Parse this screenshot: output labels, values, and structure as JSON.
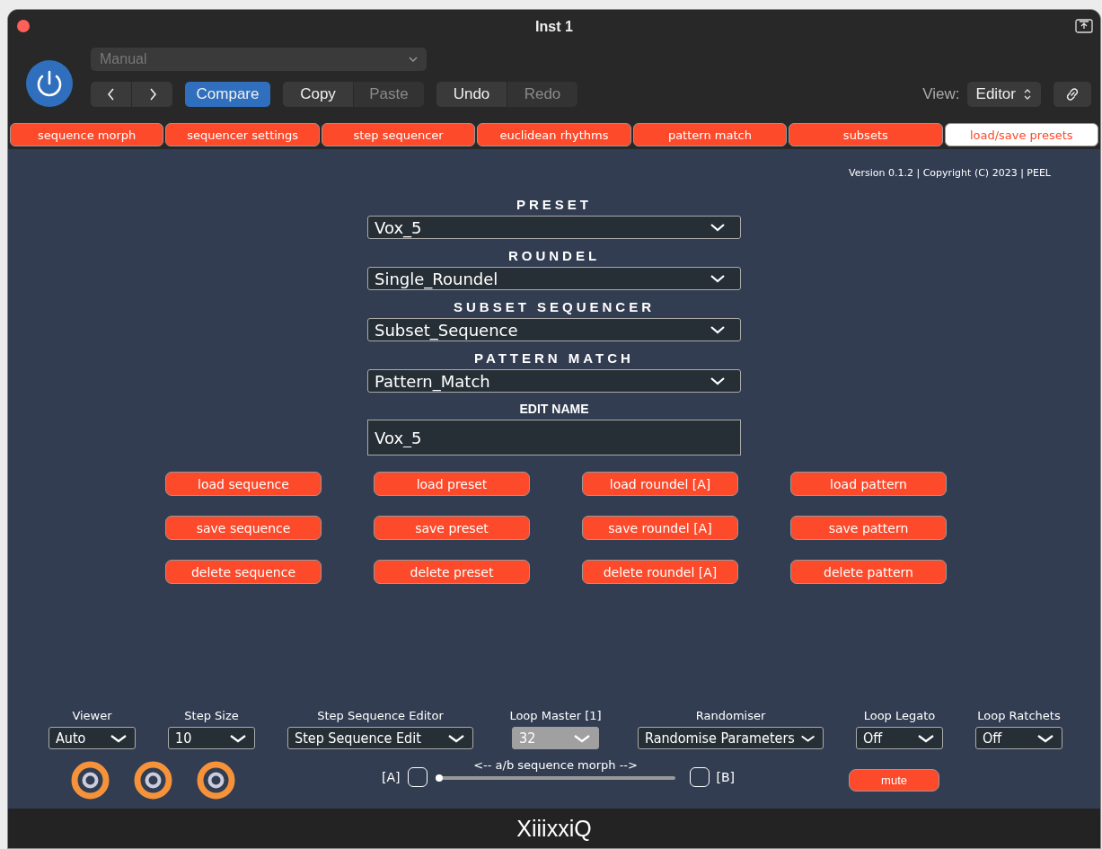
{
  "window": {
    "title": "Inst 1"
  },
  "header": {
    "preset_menu": {
      "value": "Manual",
      "disabled": true
    },
    "compare": {
      "label": "Compare",
      "selected": true
    },
    "edit_buttons": [
      {
        "label": "Copy",
        "disabled": false
      },
      {
        "label": "Paste",
        "disabled": true
      }
    ],
    "history_buttons": [
      {
        "label": "Undo",
        "disabled": false
      },
      {
        "label": "Redo",
        "disabled": true
      }
    ],
    "view_label": "View:",
    "view_menu": "Editor"
  },
  "tabs": [
    {
      "label": "sequence morph",
      "selected": false
    },
    {
      "label": "sequencer settings",
      "selected": false
    },
    {
      "label": "step sequencer",
      "selected": false
    },
    {
      "label": "euclidean rhythms",
      "selected": false
    },
    {
      "label": "pattern match",
      "selected": false
    },
    {
      "label": "subsets",
      "selected": false
    },
    {
      "label": "load/save presets",
      "selected": true
    }
  ],
  "version": "Version 0.1.2 | Copyright (C) 2023 | PEEL",
  "selects": [
    {
      "label": "PRESET",
      "value": "Vox_5"
    },
    {
      "label": "ROUNDEL",
      "value": "Single_Roundel"
    },
    {
      "label": "SUBSET SEQUENCER",
      "value": "Subset_Sequence"
    },
    {
      "label": "PATTERN MATCH",
      "value": "Pattern_Match"
    }
  ],
  "edit_name": {
    "label": "EDIT NAME",
    "value": "Vox_5"
  },
  "action_buttons": [
    [
      "load sequence",
      "load preset",
      "load roundel [A]",
      "load pattern"
    ],
    [
      "save sequence",
      "save preset",
      "save roundel [A]",
      "save pattern"
    ],
    [
      "delete sequence",
      "delete preset",
      "delete roundel [A]",
      "delete pattern"
    ]
  ],
  "bottom_menus": [
    {
      "label": "Viewer",
      "value": "Auto",
      "disabled": false
    },
    {
      "label": "Step Size",
      "value": "10",
      "disabled": false
    },
    {
      "label": "Step Sequence Editor",
      "value": "Step Sequence Edit",
      "disabled": false
    },
    {
      "label": "Loop Master [1]",
      "value": "32",
      "disabled": true
    },
    {
      "label": "Randomiser",
      "value": "Randomise Parameters",
      "disabled": false
    },
    {
      "label": "Loop Legato",
      "value": "Off",
      "disabled": false
    },
    {
      "label": "Loop Ratchets",
      "value": "Off",
      "disabled": false
    }
  ],
  "morph": {
    "label": "<-- a/b sequence morph -->",
    "a_label": "[A]",
    "a_checked": false,
    "b_label": "[B]",
    "b_checked": false,
    "level": 0
  },
  "mute": "mute",
  "footer": "XiiixxiQ"
}
